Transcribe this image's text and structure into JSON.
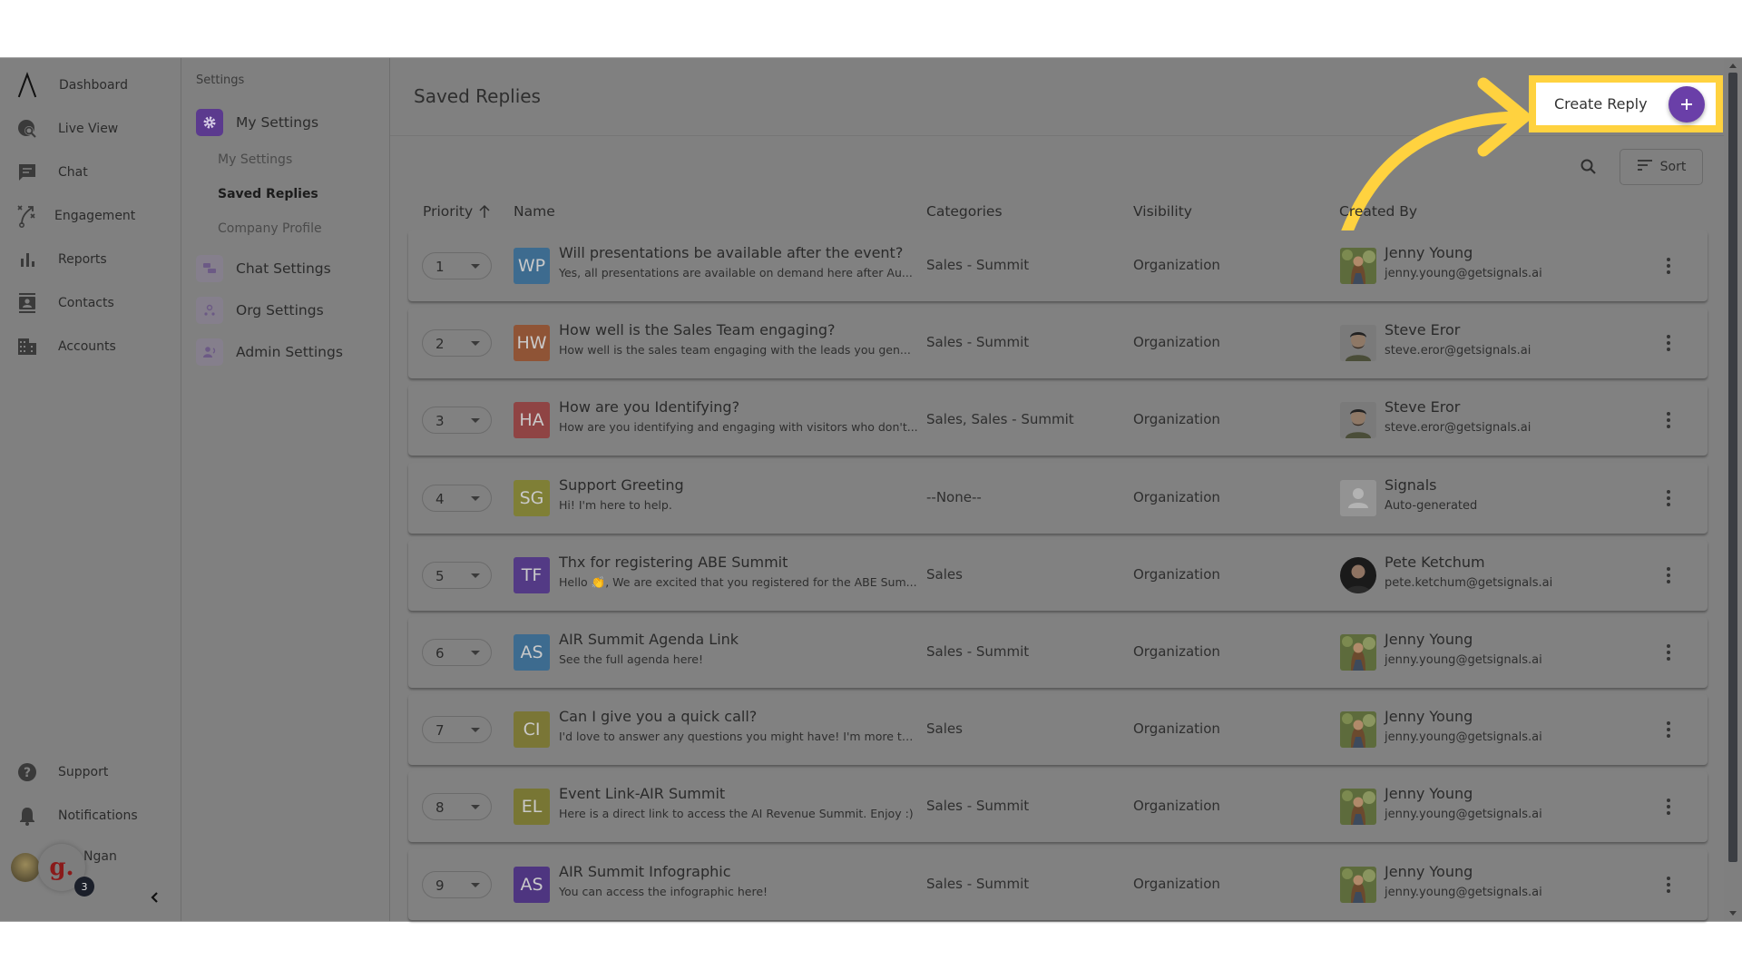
{
  "nav": {
    "items": [
      {
        "label": "Dashboard",
        "icon": "logo-icon"
      },
      {
        "label": "Live View",
        "icon": "live-view-icon"
      },
      {
        "label": "Chat",
        "icon": "chat-icon"
      },
      {
        "label": "Engagement",
        "icon": "engagement-icon"
      },
      {
        "label": "Reports",
        "icon": "reports-icon"
      },
      {
        "label": "Contacts",
        "icon": "contacts-icon"
      },
      {
        "label": "Accounts",
        "icon": "accounts-icon"
      }
    ],
    "bottom": [
      {
        "label": "Support",
        "icon": "help-icon"
      },
      {
        "label": "Notifications",
        "icon": "bell-icon"
      }
    ],
    "user": {
      "name": "Ngan",
      "app_logo": "g.",
      "badge_count": "3"
    }
  },
  "settings": {
    "title": "Settings",
    "groups": [
      {
        "label": "My Settings",
        "icon": "gear-icon",
        "active": true,
        "sub": [
          {
            "label": "My Settings",
            "active": false
          },
          {
            "label": "Saved Replies",
            "active": true
          },
          {
            "label": "Company Profile",
            "active": false
          }
        ]
      },
      {
        "label": "Chat Settings",
        "icon": "chat-settings-icon",
        "active": false
      },
      {
        "label": "Org Settings",
        "icon": "org-icon",
        "active": false
      },
      {
        "label": "Admin Settings",
        "icon": "admin-icon",
        "active": false
      }
    ]
  },
  "page": {
    "title": "Saved Replies",
    "create_label": "Create Reply",
    "sort_label": "Sort",
    "highlight_color": "#ffd23f",
    "accent_color": "#6a3fa8"
  },
  "table": {
    "headers": {
      "priority": "Priority",
      "name": "Name",
      "categories": "Categories",
      "visibility": "Visibility",
      "created_by": "Created By"
    },
    "rows": [
      {
        "priority": "1",
        "initials": "WP",
        "color": "#3d6b8f",
        "name": "Will presentations be available after the event?",
        "desc": "Yes, all presentations are available on demand here after Au...",
        "categories": "Sales - Summit",
        "visibility": "Organization",
        "creator": "Jenny Young",
        "email": "jenny.young@getsignals.ai",
        "creator_avatar": "jenny"
      },
      {
        "priority": "2",
        "initials": "HW",
        "color": "#8f5436",
        "name": "How well is the Sales Team engaging?",
        "desc": "How well is the sales team engaging with the leads you gen...",
        "categories": "Sales - Summit",
        "visibility": "Organization",
        "creator": "Steve Eror",
        "email": "steve.eror@getsignals.ai",
        "creator_avatar": "steve"
      },
      {
        "priority": "3",
        "initials": "HA",
        "color": "#8f4444",
        "name": "How are you Identifying?",
        "desc": "How are you identifying and engaging with visitors who don't...",
        "categories": "Sales, Sales - Summit",
        "visibility": "Organization",
        "creator": "Steve Eror",
        "email": "steve.eror@getsignals.ai",
        "creator_avatar": "steve"
      },
      {
        "priority": "4",
        "initials": "SG",
        "color": "#7f7f36",
        "name": "Support Greeting",
        "desc": "Hi! I'm here to help.",
        "categories": "--None--",
        "visibility": "Organization",
        "creator": "Signals",
        "email": "Auto-generated",
        "creator_avatar": "placeholder"
      },
      {
        "priority": "5",
        "initials": "TF",
        "color": "#533a85",
        "name": "Thx for registering ABE Summit",
        "desc": "Hello 👏, We are excited that you registered for the ABE Sum...",
        "categories": "Sales",
        "visibility": "Organization",
        "creator": "Pete Ketchum",
        "email": "pete.ketchum@getsignals.ai",
        "creator_avatar": "pete"
      },
      {
        "priority": "6",
        "initials": "AS",
        "color": "#3d6b8f",
        "name": "AIR Summit Agenda Link",
        "desc": "See the full agenda here!",
        "categories": "Sales - Summit",
        "visibility": "Organization",
        "creator": "Jenny Young",
        "email": "jenny.young@getsignals.ai",
        "creator_avatar": "jenny"
      },
      {
        "priority": "7",
        "initials": "CI",
        "color": "#7a7636",
        "name": "Can I give you a quick call?",
        "desc": "I'd love to answer any questions you might have! I'm more th...",
        "categories": "Sales",
        "visibility": "Organization",
        "creator": "Jenny Young",
        "email": "jenny.young@getsignals.ai",
        "creator_avatar": "jenny"
      },
      {
        "priority": "8",
        "initials": "EL",
        "color": "#787634",
        "name": "Event Link-AIR Summit",
        "desc": "Here is a direct link to access the AI Revenue Summit. Enjoy :)",
        "categories": "Sales - Summit",
        "visibility": "Organization",
        "creator": "Jenny Young",
        "email": "jenny.young@getsignals.ai",
        "creator_avatar": "jenny"
      },
      {
        "priority": "9",
        "initials": "AS",
        "color": "#4e3580",
        "name": "AIR Summit Infographic",
        "desc": "You can access the infographic here!",
        "categories": "Sales - Summit",
        "visibility": "Organization",
        "creator": "Jenny Young",
        "email": "jenny.young@getsignals.ai",
        "creator_avatar": "jenny"
      }
    ]
  }
}
